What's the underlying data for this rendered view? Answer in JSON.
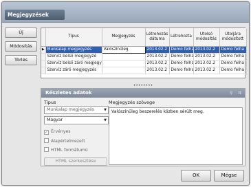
{
  "window": {
    "title": "Megjegyzések"
  },
  "sidebar": {
    "buttons": [
      "Új",
      "Módosítás",
      "Törlés"
    ]
  },
  "grid": {
    "columns": [
      "Típus",
      "Megjegyzés",
      "Létrehozás dátuma",
      "Létrehozta",
      "Utolsó módosítás",
      "Utoljára módosított"
    ],
    "rows": [
      [
        "Munkalap megjegyzés",
        "Valószínűleg",
        "2013.02.2",
        "Demo felha",
        "2013.02.2",
        "Demo felha"
      ],
      [
        "Szervíz belső megjegyzé",
        "",
        "2013.02.2",
        "Demo felha",
        "2013.02.2",
        "Demo felha"
      ],
      [
        "Szervíz belső záró megjegyzé",
        "",
        "2013.02.2",
        "Demo felha",
        "2013.02.2",
        "Demo felha"
      ],
      [
        "Szervíz záró megjegyzés",
        "",
        "2013.02.2",
        "Demo felha",
        "2013.02.2",
        "Demo felha"
      ]
    ],
    "selected_row": 0,
    "row_indicator": "▶"
  },
  "details": {
    "title": "Részletes adatok",
    "tools": [
      "⚲",
      "⁝⁝"
    ],
    "type_label": "Típus",
    "type_value": "Munkalap megjegyzés",
    "language_value": "Magyar",
    "checkboxes": [
      {
        "label": "Érvényes",
        "checked": true
      },
      {
        "label": "Alapértelmezett",
        "checked": false
      },
      {
        "label": "HTML formátumú",
        "checked": false
      }
    ],
    "checkmark": "✓",
    "html_button": "HTML szerkesztése",
    "memo_label": "Megjegyzés szövege",
    "memo_text": "Valószínűleg beszerelés közben sérült meg."
  },
  "dialog": {
    "ok": "OK",
    "cancel": "Mégse"
  },
  "splitter_glyph": "••••••••",
  "grip_glyph": "⋰",
  "dropdown_arrow": "▼"
}
